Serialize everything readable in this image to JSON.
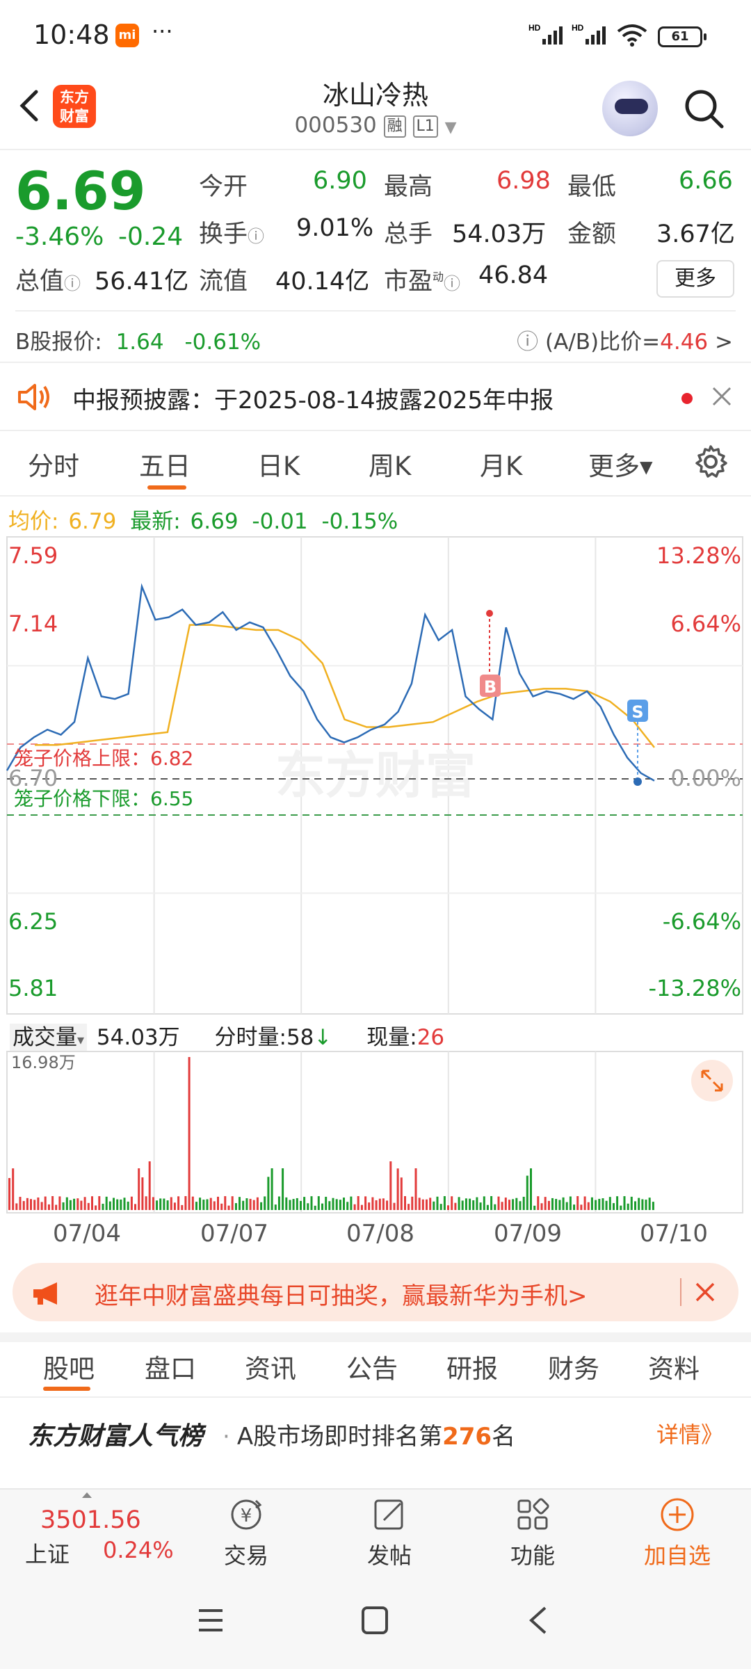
{
  "status_bar": {
    "time": "10:48",
    "app_badge": "mi",
    "dots": "···",
    "signal1": "HD",
    "signal2": "HD",
    "battery": "61"
  },
  "header": {
    "logo_line1": "东方",
    "logo_line2": "财富",
    "stock_name": "冰山冷热",
    "stock_code": "000530",
    "tag_margin": "融",
    "tag_level": "L1"
  },
  "quote": {
    "price": "6.69",
    "pct_change": "-3.46%",
    "abs_change": "-0.24",
    "open_label": "今开",
    "open": "6.90",
    "high_label": "最高",
    "high": "6.98",
    "low_label": "最低",
    "low": "6.66",
    "turnover_label": "换手",
    "turnover": "9.01%",
    "volume_label": "总手",
    "volume": "54.03万",
    "amount_label": "金额",
    "amount": "3.67亿",
    "mcap_label": "总值",
    "mcap": "56.41亿",
    "float_label": "流值",
    "float": "40.14亿",
    "pe_label": "市盈",
    "pe_sup": "动",
    "pe": "46.84",
    "more_label": "更多"
  },
  "b_share": {
    "label": "B股报价:",
    "price": "1.64",
    "change": "-0.61%",
    "ratio_label": "(A/B)比价=",
    "ratio": "4.46",
    "arrow": ">"
  },
  "notice": {
    "text": "中报预披露：于2025-08-14披露2025年中报"
  },
  "period_tabs": [
    "分时",
    "五日",
    "日K",
    "周K",
    "月K",
    "更多▾"
  ],
  "active_period_tab": "五日",
  "legend": {
    "avg_label": "均价:",
    "avg": "6.79",
    "latest_label": "最新:",
    "latest": "6.69",
    "change": "-0.01",
    "pct": "-0.15%"
  },
  "price_chart": {
    "left_labels": [
      "7.59",
      "7.14",
      "6.70",
      "6.25",
      "5.81"
    ],
    "right_labels": [
      "13.28%",
      "6.64%",
      "0.00%",
      "-6.64%",
      "-13.28%"
    ],
    "upper_limit_label": "笼子价格上限：6.82",
    "lower_limit_label": "笼子价格下限：6.55",
    "watermark": "东方财富",
    "buy_marker": "B",
    "sell_marker": "S"
  },
  "chart_data": {
    "type": "line",
    "title": "",
    "x": [
      "07/04",
      "07/07",
      "07/08",
      "07/09",
      "07/10"
    ],
    "ylim": [
      5.81,
      7.59
    ],
    "prev_close": 6.7,
    "series": [
      {
        "name": "最新",
        "values": [
          6.73,
          6.82,
          6.86,
          6.89,
          6.87,
          6.92,
          7.17,
          7.02,
          7.01,
          7.03,
          7.45,
          7.32,
          7.33,
          7.36,
          7.3,
          7.31,
          7.35,
          7.28,
          7.31,
          7.29,
          7.2,
          7.1,
          7.04,
          6.93,
          6.86,
          6.84,
          6.86,
          6.89,
          6.91,
          6.96,
          7.07,
          7.34,
          7.24,
          7.28,
          7.02,
          6.97,
          6.93,
          7.29,
          7.11,
          7.02,
          7.04,
          7.03,
          7.01,
          7.04,
          6.98,
          6.87,
          6.78,
          6.72,
          6.69
        ]
      },
      {
        "name": "均价",
        "values": [
          6.83,
          6.83,
          6.84,
          6.85,
          6.86,
          6.87,
          6.88,
          7.3,
          7.3,
          7.29,
          7.28,
          7.28,
          7.24,
          7.15,
          6.93,
          6.9,
          6.9,
          6.91,
          6.92,
          6.96,
          7.0,
          7.03,
          7.04,
          7.05,
          7.05,
          7.04,
          7.0,
          6.93,
          6.82
        ]
      }
    ],
    "volume": {
      "max_label": "16.98万"
    }
  },
  "volume_header": {
    "label": "成交量",
    "arrow": "▾",
    "total": "54.03万",
    "interval_label": "分时量:58",
    "interval_arrow": "↓",
    "current_label": "现量:",
    "current": "26"
  },
  "promo": {
    "text": "逛年中财富盛典每日可抽奖，赢最新华为手机>"
  },
  "bottom_tabs": [
    "股吧",
    "盘口",
    "资讯",
    "公告",
    "研报",
    "财务",
    "资料"
  ],
  "active_bottom_tab": "股吧",
  "ranking": {
    "brand": "东方财富人气榜",
    "dot": "·",
    "prefix": "A股市场即时排名第",
    "rank": "276",
    "suffix": "名",
    "detail": "详情》"
  },
  "toolbar": {
    "index_value": "3501.56",
    "index_name": "上证",
    "index_pct": "0.24%",
    "trade_label": "交易",
    "post_label": "发帖",
    "function_label": "功能",
    "watchlist_label": "加自选"
  },
  "colors": {
    "up": "#e23a3a",
    "down": "#1a9b2c",
    "accent": "#f06a1a",
    "avg_line": "#f0b020",
    "price_line": "#2c6bb5"
  }
}
